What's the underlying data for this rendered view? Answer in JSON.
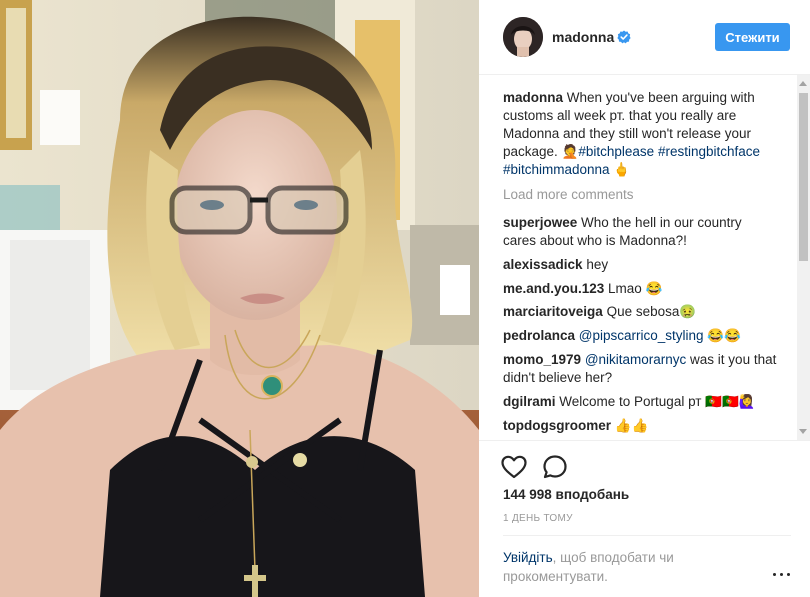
{
  "post": {
    "photo_icon": "selfie-photo"
  },
  "header": {
    "username": "madonna",
    "verified_icon": "verified-badge-icon",
    "follow_label": "Стежити",
    "accent": "#3897f0"
  },
  "caption": {
    "username": "madonna",
    "text": " When you've been arguing with customs all week рт. that you really are Madonna and they still won't release your package. ",
    "emoji_1": "🤦",
    "hashtags": [
      "#bitchplease",
      "#restingbitchface",
      "#bitchimmadonna"
    ],
    "emoji_2": "🖕"
  },
  "load_more": "Load more comments",
  "comments": [
    {
      "user": "superjowee",
      "text": " Who the hell in our country cares about who is Madonna?!"
    },
    {
      "user": "alexissadick",
      "text": " hey"
    },
    {
      "user": "me.and.you.123",
      "text": " Lmao 😂"
    },
    {
      "user": "marciaritoveiga",
      "text": " Que sebosa🤢"
    },
    {
      "user": "pedrolanca",
      "mention": "@pipscarrico_styling",
      "text": " 😂😂"
    },
    {
      "user": "momo_1979",
      "mention": "@nikitamorarnyc",
      "text": " was it you that didn't believe her?"
    },
    {
      "user": "dgilrami",
      "text": " Welcome to Portugal рт 🇵🇹🇵🇹🙋‍♀️"
    },
    {
      "user": "topdogsgroomer",
      "text": " 👍👍"
    }
  ],
  "actions": {
    "like_icon": "heart-icon",
    "comment_icon": "comment-bubble-icon",
    "likes": "144 998 вподобань",
    "time": "1 ДЕНЬ ТОМУ",
    "login_link": "Увійдіть",
    "login_text": ", щоб вподобати чи прокоментувати.",
    "more_icon": "more-options-icon"
  }
}
